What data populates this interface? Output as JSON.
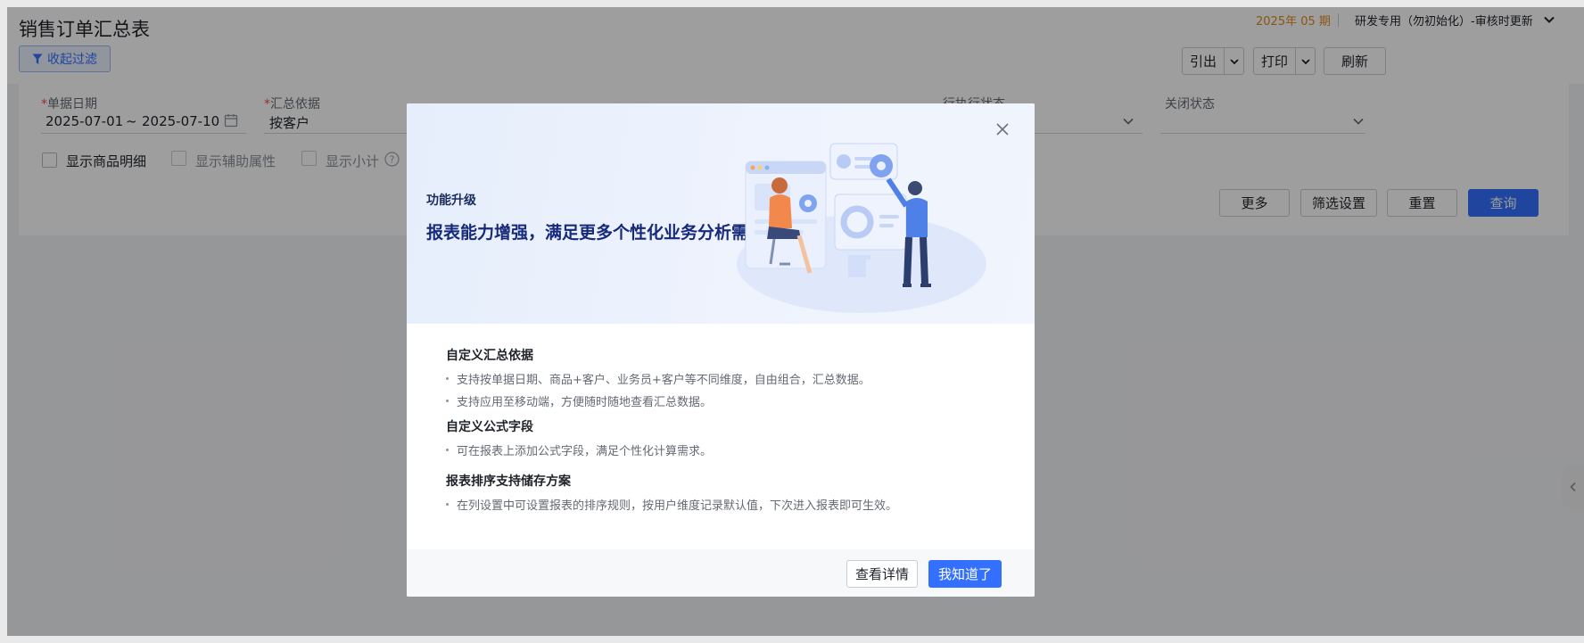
{
  "header": {
    "title": "销售订单汇总表",
    "period": "2025年 05 期",
    "account": "研发专用（勿初始化）-审核时更新",
    "filter_toggle": "收起过滤"
  },
  "toolbar": {
    "export_label": "引出",
    "print_label": "打印",
    "refresh_label": "刷新"
  },
  "filters": {
    "date_label": "单据日期",
    "date_from": "2025-07-01",
    "date_sep": "~",
    "date_to": "2025-07-10",
    "group_label": "汇总依据",
    "group_value": "按客户",
    "row_status_label": "行执行状态",
    "close_status_label": "关闭状态",
    "show_goods_detail": "显示商品明细",
    "show_aux_attr": "显示辅助属性",
    "show_subtotal": "显示小计",
    "more_label": "更多",
    "filter_settings_label": "筛选设置",
    "reset_label": "重置",
    "query_label": "查询"
  },
  "modal": {
    "banner_sub": "功能升级",
    "banner_title": "报表能力增强，满足更多个性化业务分析需求",
    "sections": [
      {
        "title": "自定义汇总依据",
        "items": [
          "支持按单据日期、商品+客户、业务员+客户等不同维度，自由组合，汇总数据。",
          "支持应用至移动端，方便随时随地查看汇总数据。"
        ]
      },
      {
        "title": "自定义公式字段",
        "items": [
          "可在报表上添加公式字段，满足个性化计算需求。"
        ]
      },
      {
        "title": "报表排序支持储存方案",
        "items": [
          "在列设置中可设置报表的排序规则，按用户维度记录默认值，下次进入报表即可生效。"
        ]
      }
    ],
    "detail_label": "查看详情",
    "ok_label": "我知道了"
  },
  "colors": {
    "primary": "#3370ff",
    "period": "#e08a1e",
    "required": "#f54a45"
  }
}
